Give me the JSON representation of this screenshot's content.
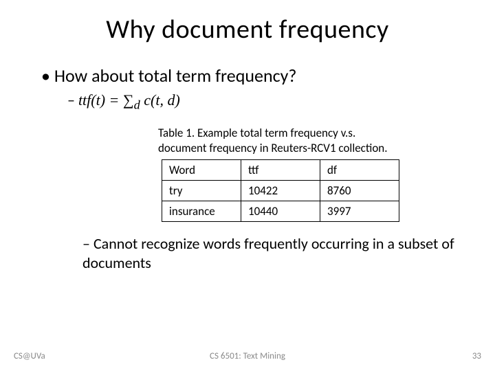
{
  "title": "Why document frequency",
  "bullet1": "How about total term frequency?",
  "formula": "ttf(t) = ∑",
  "formula_sub": "d",
  "formula_rest": " c(t, d)",
  "caption_line1": "Table 1. Example total term frequency v.s.",
  "caption_line2": "document frequency in Reuters-RCV1 collection.",
  "chart_data": {
    "type": "table",
    "columns": [
      "Word",
      "ttf",
      "df"
    ],
    "rows": [
      [
        "try",
        "10422",
        "8760"
      ],
      [
        "insurance",
        "10440",
        "3997"
      ]
    ]
  },
  "note": "Cannot recognize words frequently occurring in a subset of documents",
  "footer": {
    "left": "CS@UVa",
    "center": "CS 6501: Text Mining",
    "right": "33"
  }
}
